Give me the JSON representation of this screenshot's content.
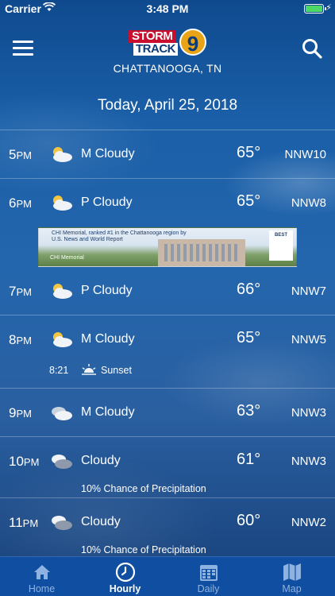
{
  "status_bar": {
    "carrier": "Carrier",
    "time": "3:48 PM",
    "battery_level": 1.0
  },
  "header": {
    "logo_line1": "STORM",
    "logo_line2": "TRACK",
    "logo_number": "9",
    "city": "CHATTANOOGA, TN"
  },
  "date_label": "Today, April 25, 2018",
  "hours": [
    {
      "hour": "5",
      "ampm": "PM",
      "icon": "partly-cloudy-icon",
      "condition": "M Cloudy",
      "temp": "65°",
      "wind": "NNW10"
    },
    {
      "hour": "6",
      "ampm": "PM",
      "icon": "partly-cloudy-icon",
      "condition": "P Cloudy",
      "temp": "65°",
      "wind": "NNW8"
    },
    {
      "hour": "7",
      "ampm": "PM",
      "icon": "partly-cloudy-icon",
      "condition": "P Cloudy",
      "temp": "66°",
      "wind": "NNW7"
    },
    {
      "hour": "8",
      "ampm": "PM",
      "icon": "partly-cloudy-icon",
      "condition": "M Cloudy",
      "temp": "65°",
      "wind": "NNW5",
      "event_time": "8:21",
      "event_label": "Sunset"
    },
    {
      "hour": "9",
      "ampm": "PM",
      "icon": "cloudy-icon",
      "condition": "M Cloudy",
      "temp": "63°",
      "wind": "NNW3"
    },
    {
      "hour": "10",
      "ampm": "PM",
      "icon": "cloudy-icon",
      "condition": "Cloudy",
      "temp": "61°",
      "wind": "NNW3",
      "note": "10% Chance of Precipitation"
    },
    {
      "hour": "11",
      "ampm": "PM",
      "icon": "cloudy-icon",
      "condition": "Cloudy",
      "temp": "60°",
      "wind": "NNW2",
      "note": "10% Chance of Precipitation"
    }
  ],
  "ad": {
    "headline": "CHI Memorial, ranked #1 in the Chattanooga region by U.S. News and World Report",
    "sponsor": "CHI Memorial",
    "badge": "BEST"
  },
  "tabs": [
    {
      "label": "Home",
      "icon": "home-icon"
    },
    {
      "label": "Hourly",
      "icon": "clock-icon"
    },
    {
      "label": "Daily",
      "icon": "calendar-icon"
    },
    {
      "label": "Map",
      "icon": "map-icon"
    }
  ],
  "colors": {
    "accent_bg": "#0f4ea0",
    "text": "#ffffff",
    "inactive_tab": "#8fb3e0"
  }
}
